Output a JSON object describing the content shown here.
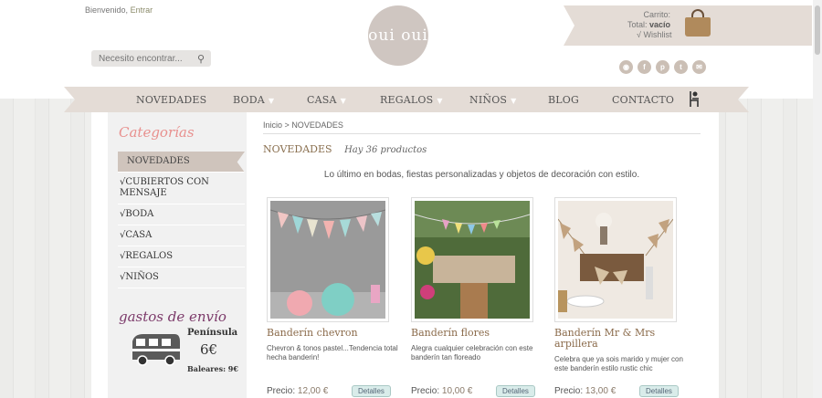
{
  "header": {
    "welcome": "Bienvenido,",
    "login": "Entrar",
    "logo": "oui oui",
    "search_placeholder": "Necesito encontrar...",
    "cart_label": "Carrito:",
    "total_label": "Total:",
    "total_value": "vacío",
    "wishlist": "Wishlist"
  },
  "social": [
    "rss",
    "facebook",
    "pinterest",
    "twitter",
    "mail"
  ],
  "nav": {
    "items": [
      {
        "label": "NOVEDADES",
        "arrow": ""
      },
      {
        "label": "BODA",
        "arrow": "▼"
      },
      {
        "label": "CASA",
        "arrow": "▼"
      },
      {
        "label": "REGALOS",
        "arrow": "▼"
      },
      {
        "label": "NIÑOS",
        "arrow": "▼"
      },
      {
        "label": "BLOG",
        "arrow": ""
      },
      {
        "label": "CONTACTO",
        "arrow": ""
      }
    ]
  },
  "sidebar": {
    "title": "Categorías",
    "categories": [
      "NOVEDADES",
      "CUBIERTOS CON MENSAJE",
      "BODA",
      "CASA",
      "REGALOS",
      "NIÑOS"
    ],
    "shipping_title": "gastos de envío",
    "peninsula": "Península",
    "peninsula_price": "6€",
    "baleares": "Baleares: 9€"
  },
  "main": {
    "breadcrumb_home": "Inicio",
    "breadcrumb_sep": ">",
    "breadcrumb_current": "NOVEDADES",
    "heading": "NOVEDADES",
    "count": "Hay 36 productos",
    "intro": "Lo último en bodas, fiestas personalizadas y objetos de decoración con estilo."
  },
  "products": [
    {
      "title": "Banderín chevron",
      "desc": "Chevron & tonos pastel...Tendencia total hecha banderin!",
      "price_label": "Precio:",
      "price": "12,00 €",
      "button": "Detalles"
    },
    {
      "title": "Banderín flores",
      "desc": "Alegra cualquier celebración con este banderín tan floreado",
      "price_label": "Precio:",
      "price": "10,00 €",
      "button": "Detalles"
    },
    {
      "title": "Banderín Mr & Mrs arpillera",
      "desc": "Celebra que ya sois marido y mujer con este banderín estilo rustic chic",
      "price_label": "Precio:",
      "price": "13,00 €",
      "button": "Detalles"
    }
  ]
}
